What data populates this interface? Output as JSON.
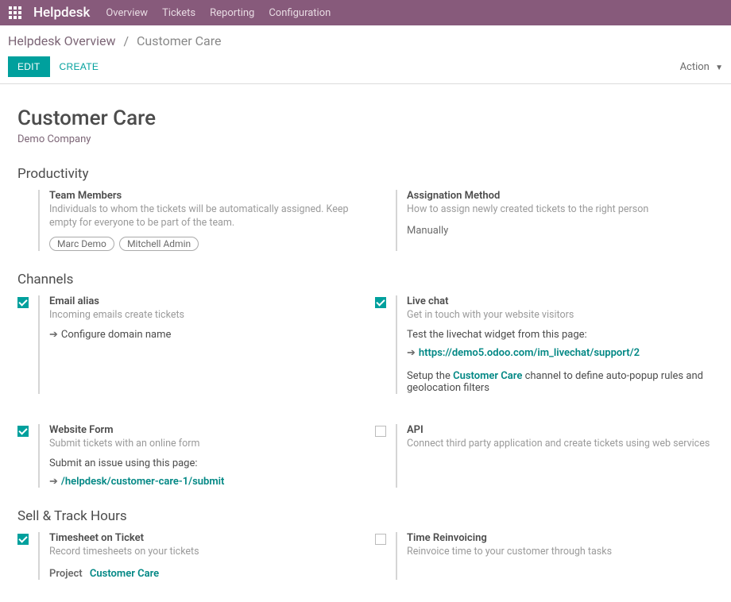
{
  "topbar": {
    "app_title": "Helpdesk",
    "nav": {
      "overview": "Overview",
      "tickets": "Tickets",
      "reporting": "Reporting",
      "configuration": "Configuration"
    }
  },
  "breadcrumb": {
    "root": "Helpdesk Overview",
    "sep": "/",
    "current": "Customer Care"
  },
  "actions": {
    "edit": "EDIT",
    "create": "CREATE",
    "action": "Action"
  },
  "header": {
    "title": "Customer Care",
    "company": "Demo Company"
  },
  "sections": {
    "productivity": "Productivity",
    "channels": "Channels",
    "selltrack": "Sell & Track Hours"
  },
  "productivity": {
    "team_members": {
      "label": "Team Members",
      "desc": "Individuals to whom the tickets will be automatically assigned. Keep empty for everyone to be part of the team.",
      "tag1": "Marc Demo",
      "tag2": "Mitchell Admin"
    },
    "assignation": {
      "label": "Assignation Method",
      "desc": "How to assign newly created tickets to the right person",
      "value": "Manually"
    }
  },
  "channels": {
    "email": {
      "label": "Email alias",
      "desc": "Incoming emails create tickets",
      "link": "Configure domain name"
    },
    "livechat": {
      "label": "Live chat",
      "desc": "Get in touch with your website visitors",
      "test_line": "Test the livechat widget from this page:",
      "link": "https://demo5.odoo.com/im_livechat/support/2",
      "setup_pre": "Setup the ",
      "setup_ch": "Customer Care",
      "setup_post": " channel to define auto-popup rules and geolocation filters"
    },
    "webform": {
      "label": "Website Form",
      "desc": "Submit tickets with an online form",
      "submit_line": "Submit an issue using this page:",
      "link": "/helpdesk/customer-care-1/submit"
    },
    "api": {
      "label": "API",
      "desc": "Connect third party application and create tickets using web services"
    }
  },
  "selltrack": {
    "timesheet": {
      "label": "Timesheet on Ticket",
      "desc": "Record timesheets on your tickets",
      "project_label": "Project",
      "project_value": "Customer Care"
    },
    "reinvoice": {
      "label": "Time Reinvoicing",
      "desc": "Reinvoice time to your customer through tasks"
    }
  }
}
